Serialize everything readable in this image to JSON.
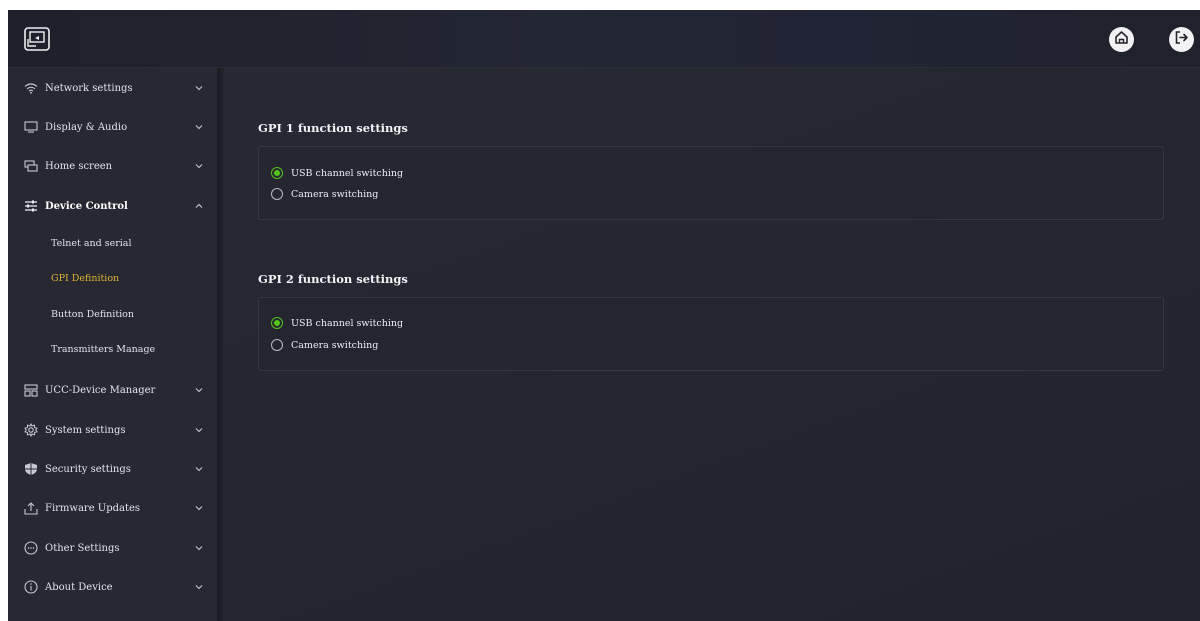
{
  "header": {
    "logo_icon": "device-screen-logo-icon",
    "home_icon": "home-icon",
    "logout_icon": "logout-icon"
  },
  "sidebar": {
    "items": [
      {
        "label": "Network settings",
        "icon": "wifi-icon",
        "expanded": false
      },
      {
        "label": "Display & Audio",
        "icon": "monitor-icon",
        "expanded": false
      },
      {
        "label": "Home screen",
        "icon": "windows-icon",
        "expanded": false
      },
      {
        "label": "Device Control",
        "icon": "sliders-icon",
        "expanded": true,
        "sub_items": [
          {
            "label": "Telnet and serial",
            "active": false
          },
          {
            "label": "GPI Definition",
            "active": true
          },
          {
            "label": "Button Definition",
            "active": false
          },
          {
            "label": "Transmitters Manage",
            "active": false
          }
        ]
      },
      {
        "label": "UCC-Device Manager",
        "icon": "device-manager-icon",
        "expanded": false
      },
      {
        "label": "System settings",
        "icon": "gear-icon",
        "expanded": false
      },
      {
        "label": "Security settings",
        "icon": "shield-icon",
        "expanded": false
      },
      {
        "label": "Firmware Updates",
        "icon": "upload-icon",
        "expanded": false
      },
      {
        "label": "Other Settings",
        "icon": "more-circle-icon",
        "expanded": false
      },
      {
        "label": "About Device",
        "icon": "info-icon",
        "expanded": false
      }
    ]
  },
  "main": {
    "sections": [
      {
        "title": "GPI 1 function settings",
        "options": [
          {
            "label": "USB channel switching",
            "selected": true
          },
          {
            "label": "Camera switching",
            "selected": false
          }
        ]
      },
      {
        "title": "GPI 2 function settings",
        "options": [
          {
            "label": "USB channel switching",
            "selected": true
          },
          {
            "label": "Camera switching",
            "selected": false
          }
        ]
      }
    ]
  },
  "colors": {
    "accent_active": "#e0b334",
    "radio_selected": "#52c41a",
    "background": "#23242d"
  }
}
